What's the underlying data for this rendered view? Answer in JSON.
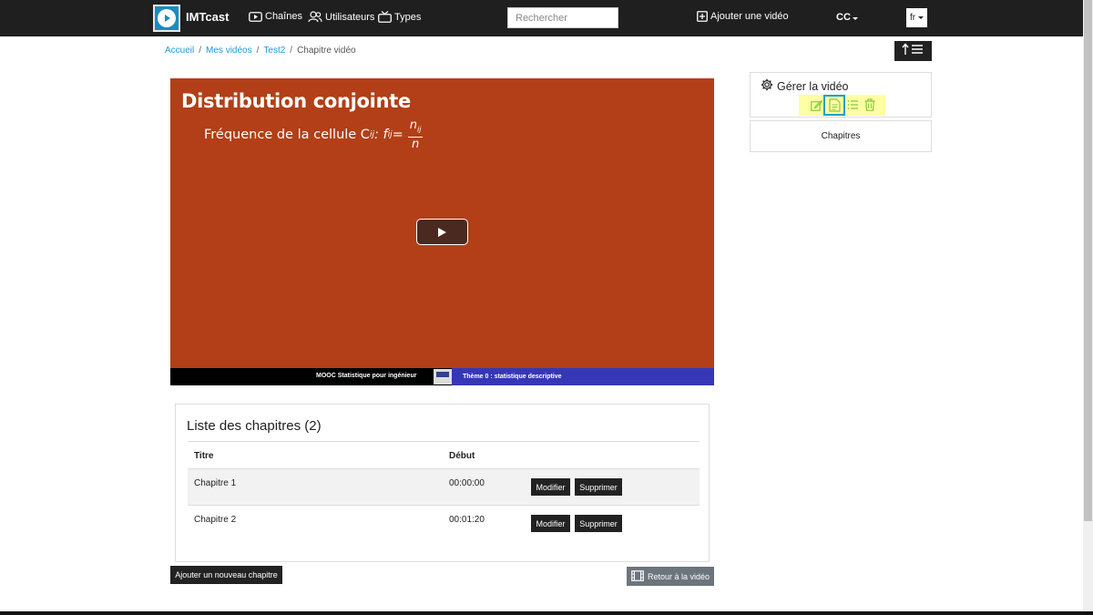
{
  "navbar": {
    "brand": "IMTcast",
    "links": {
      "channels": "Chaînes",
      "users": "Utilisateurs",
      "types": "Types"
    },
    "search_placeholder": "Rechercher",
    "add_video": "Ajouter une vidéo",
    "cc_label": "CC",
    "lang": "fr"
  },
  "breadcrumb": {
    "items": [
      "Accueil",
      "Mes vidéos",
      "Test2"
    ],
    "current": "Chapitre vidéo"
  },
  "video": {
    "slide_title": "Distribution conjointe",
    "formula_text": "Fréquence de la cellule C",
    "formula_sub": "ij",
    "formula_mid": " : f",
    "formula_sub2": "ij",
    "formula_eq": " =",
    "frac_num": "n",
    "frac_num_sub": "ij",
    "frac_den": "n",
    "footer_left": "MOOC Statistique pour ingénieur",
    "footer_right": "Thème 0 : statistique descriptive"
  },
  "chapters": {
    "title": "Liste des chapitres (2)",
    "headers": {
      "title": "Titre",
      "start": "Début"
    },
    "rows": [
      {
        "title": "Chapitre 1",
        "start": "00:00:00",
        "edit": "Modifier",
        "delete": "Supprimer"
      },
      {
        "title": "Chapitre 2",
        "start": "00:01:20",
        "edit": "Modifier",
        "delete": "Supprimer"
      }
    ],
    "add_button": "Ajouter un nouveau chapitre",
    "back_button": "Retour à la vidéo"
  },
  "sidebar": {
    "manage_title": "Gérer la vidéo",
    "chapters_label": "Chapitres",
    "icons": [
      "edit-icon",
      "document-icon",
      "list-icon",
      "trash-icon"
    ],
    "icon_color": "#8dc63f",
    "highlight_color": "#14a0c4",
    "action_bg": "#fefea4"
  },
  "colors": {
    "link": "#1e9bd3",
    "video_bg": "#b23f17",
    "navbar_bg": "#1f1f1f"
  }
}
